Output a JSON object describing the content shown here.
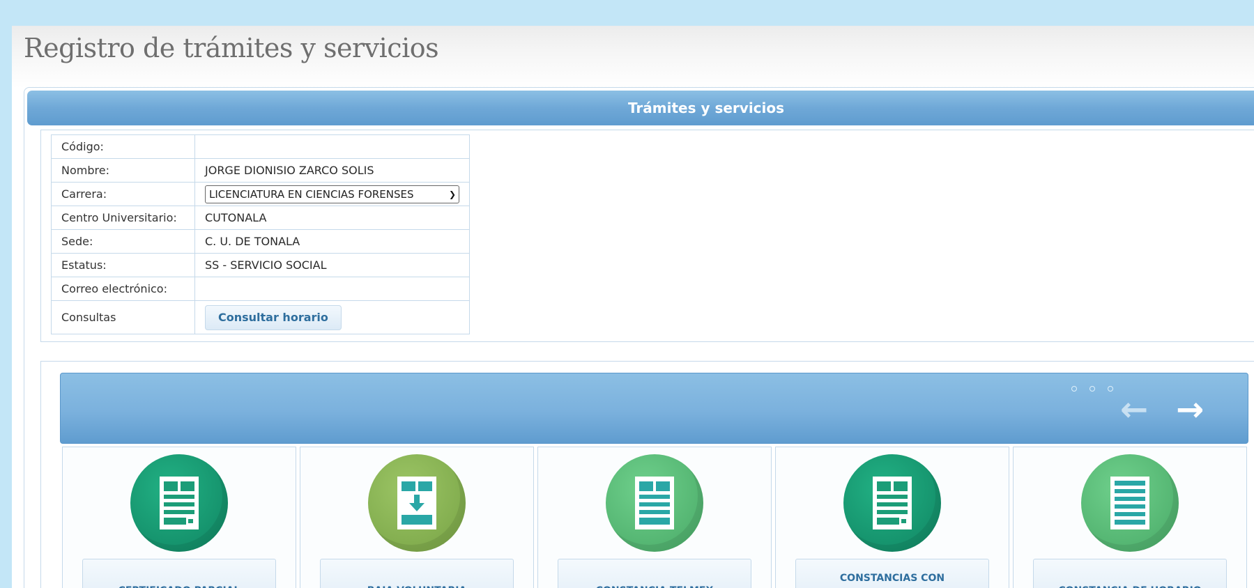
{
  "page": {
    "title": "Registro de trámites y servicios"
  },
  "panel": {
    "title": "Trámites y servicios"
  },
  "info": {
    "codigo_label": "Código:",
    "codigo_value": "",
    "nombre_label": "Nombre:",
    "nombre_value": "JORGE DIONISIO ZARCO SOLIS",
    "carrera_label": "Carrera:",
    "carrera_value": "LICENCIATURA EN CIENCIAS FORENSES",
    "centro_label": "Centro Universitario:",
    "centro_value": "CUTONALA",
    "sede_label": "Sede:",
    "sede_value": "C. U. DE TONALA",
    "estatus_label": "Estatus:",
    "estatus_value": "SS - SERVICIO SOCIAL",
    "correo_label": "Correo electrónico:",
    "correo_value": "",
    "consultas_label": "Consultas",
    "consultar_button": "Consultar horario"
  },
  "carousel": {
    "prev_icon": "arrow-left-icon",
    "next_icon": "arrow-right-icon",
    "page_indicator_count": 3
  },
  "services": [
    {
      "label": "CERTIFICADO PARCIAL",
      "icon": "document-icon",
      "color": "#1a9b72"
    },
    {
      "label": "BAJA VOLUNTARIA",
      "icon": "download-document-icon",
      "color": "#8bb656"
    },
    {
      "label": "CONSTANCIA TELMEX",
      "icon": "document-icon",
      "color": "#5cbd7a"
    },
    {
      "label": "CONSTANCIAS CON",
      "icon": "document-icon",
      "color": "#1a9b72"
    },
    {
      "label": "CONSTANCIA DE HORARIO",
      "icon": "list-document-icon",
      "color": "#5cbd7a"
    }
  ]
}
